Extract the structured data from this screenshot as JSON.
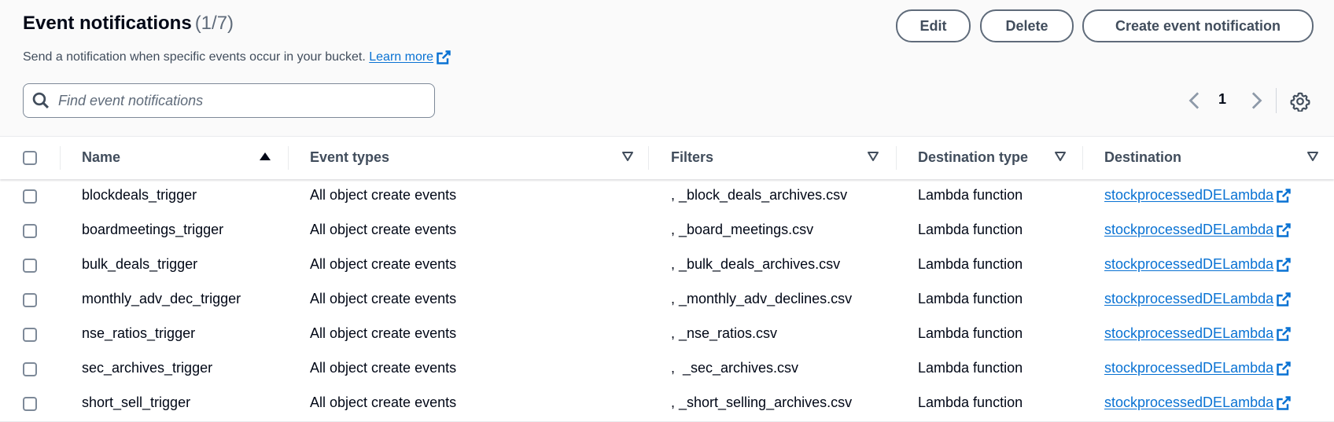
{
  "header": {
    "title": "Event notifications",
    "count": "(1/7)",
    "description": "Send a notification when specific events occur in your bucket.",
    "learn_more": "Learn more"
  },
  "buttons": {
    "edit": "Edit",
    "delete": "Delete",
    "create": "Create event notification"
  },
  "search": {
    "placeholder": "Find event notifications",
    "value": ""
  },
  "pagination": {
    "current_page": "1"
  },
  "columns": {
    "name": "Name",
    "event_types": "Event types",
    "filters": "Filters",
    "destination_type": "Destination type",
    "destination": "Destination"
  },
  "rows": [
    {
      "name": "blockdeals_trigger",
      "event_types": "All object create events",
      "filters": ", _block_deals_archives.csv",
      "destination_type": "Lambda function",
      "destination": "stockprocessedDELambda"
    },
    {
      "name": "boardmeetings_trigger",
      "event_types": "All object create events",
      "filters": ", _board_meetings.csv",
      "destination_type": "Lambda function",
      "destination": "stockprocessedDELambda"
    },
    {
      "name": "bulk_deals_trigger",
      "event_types": "All object create events",
      "filters": ", _bulk_deals_archives.csv",
      "destination_type": "Lambda function",
      "destination": "stockprocessedDELambda"
    },
    {
      "name": "monthly_adv_dec_trigger",
      "event_types": "All object create events",
      "filters": ", _monthly_adv_declines.csv",
      "destination_type": "Lambda function",
      "destination": "stockprocessedDELambda"
    },
    {
      "name": "nse_ratios_trigger",
      "event_types": "All object create events",
      "filters": ", _nse_ratios.csv",
      "destination_type": "Lambda function",
      "destination": "stockprocessedDELambda"
    },
    {
      "name": "sec_archives_trigger",
      "event_types": "All object create events",
      "filters": ",  _sec_archives.csv",
      "destination_type": "Lambda function",
      "destination": "stockprocessedDELambda"
    },
    {
      "name": "short_sell_trigger",
      "event_types": "All object create events",
      "filters": ", _short_selling_archives.csv",
      "destination_type": "Lambda function",
      "destination": "stockprocessedDELambda"
    }
  ],
  "colors": {
    "link": "#0972d3",
    "heading_text": "#000716",
    "secondary_text": "#414d5c",
    "button_border": "#5f6b7a"
  },
  "icons": {
    "search": "search-icon",
    "external": "external-link-icon",
    "prev": "chevron-left-icon",
    "next": "chevron-right-icon",
    "settings": "gear-icon",
    "sort_asc": "sort-ascending-icon",
    "sort": "sort-icon"
  }
}
